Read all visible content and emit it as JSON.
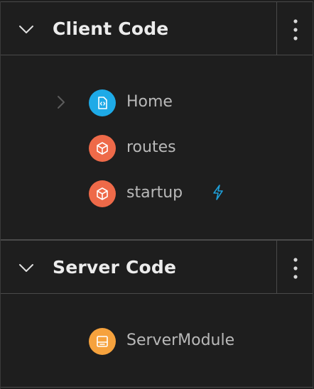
{
  "colors": {
    "background": "#1e1e1e",
    "border": "#4a4a4a",
    "page_icon": "#1eaae7",
    "component_icon": "#ee6a49",
    "module_icon": "#f6a23d",
    "bolt": "#1e9fd8"
  },
  "client_section": {
    "title": "Client Code",
    "toggle_icon": "chevron-down-icon",
    "menu_icon": "kebab-menu-icon",
    "items": [
      {
        "label": "Home",
        "icon": "page-code-icon",
        "has_children": true
      },
      {
        "label": "routes",
        "icon": "component-cube-icon"
      },
      {
        "label": "startup",
        "icon": "component-cube-icon",
        "badge_icon": "lightning-bolt-icon"
      }
    ]
  },
  "server_section": {
    "title": "Server Code",
    "toggle_icon": "chevron-down-icon",
    "menu_icon": "kebab-menu-icon",
    "items": [
      {
        "label": "ServerModule",
        "icon": "server-module-icon"
      }
    ]
  }
}
